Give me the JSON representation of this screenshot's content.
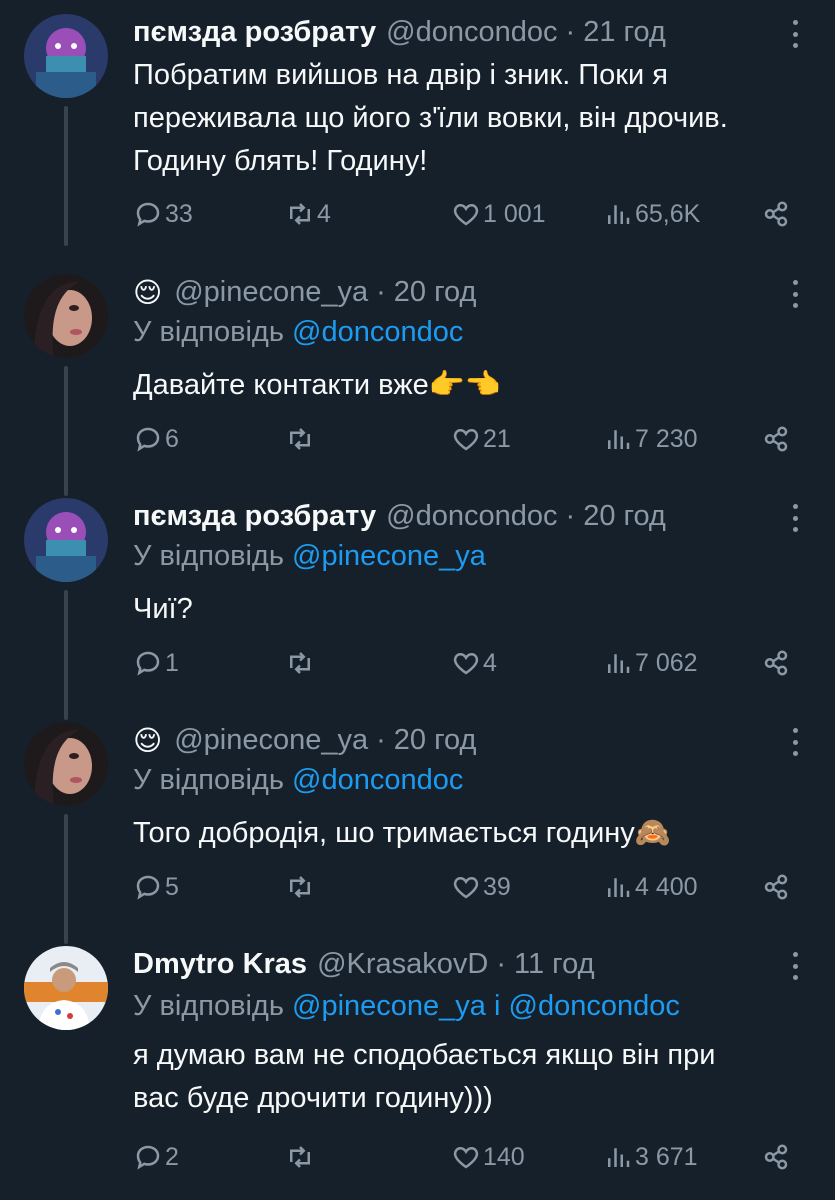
{
  "tweets": [
    {
      "display_name": "пємзда розбрату",
      "name_emoji": "",
      "handle": "@doncondoc",
      "time": "21 год",
      "reply_prefix": "",
      "reply_to": [],
      "text": [
        "Побратим вийшов на двір і зник. Поки я",
        "переживала що його з'їли вовки, він дрочив.",
        "Годину блять! Годину!"
      ],
      "replies": "33",
      "retweets": "4",
      "likes": "1 001",
      "views": "65,6K"
    },
    {
      "display_name": "",
      "name_emoji": "😌",
      "handle": "@pinecone_ya",
      "time": "20 год",
      "reply_prefix": "У відповідь",
      "reply_to": [
        "@doncondoc"
      ],
      "text": [
        "Давайте контакти вже👉👈"
      ],
      "replies": "6",
      "retweets": "",
      "likes": "21",
      "views": "7 230"
    },
    {
      "display_name": "пємзда розбрату",
      "name_emoji": "",
      "handle": "@doncondoc",
      "time": "20 год",
      "reply_prefix": "У відповідь",
      "reply_to": [
        "@pinecone_ya"
      ],
      "text": [
        "Чиї?"
      ],
      "replies": "1",
      "retweets": "",
      "likes": "4",
      "views": "7 062"
    },
    {
      "display_name": "",
      "name_emoji": "😌",
      "handle": "@pinecone_ya",
      "time": "20 год",
      "reply_prefix": "У відповідь",
      "reply_to": [
        "@doncondoc"
      ],
      "text": [
        "Того добродія, шо тримається годину🙈"
      ],
      "replies": "5",
      "retweets": "",
      "likes": "39",
      "views": "4 400"
    },
    {
      "display_name": "Dmytro Kras",
      "name_emoji": "",
      "handle": "@KrasakovD",
      "time": "11 год",
      "reply_prefix": "У відповідь",
      "reply_to": [
        "@pinecone_ya",
        "і",
        "@doncondoc"
      ],
      "text": [
        "я думаю вам не сподобається якщо він при",
        "вас буде дрочити годину)))"
      ],
      "replies": "2",
      "retweets": "",
      "likes": "140",
      "views": "3 671"
    }
  ],
  "separator": "·",
  "colors": {
    "background": "#15202b",
    "text": "#f7f9f9",
    "secondary": "#8b98a5",
    "accent": "#1d9bf0",
    "thread_line": "#38444d"
  },
  "icons": [
    "reply-icon",
    "retweet-icon",
    "like-icon",
    "views-icon",
    "share-icon",
    "more-icon"
  ]
}
